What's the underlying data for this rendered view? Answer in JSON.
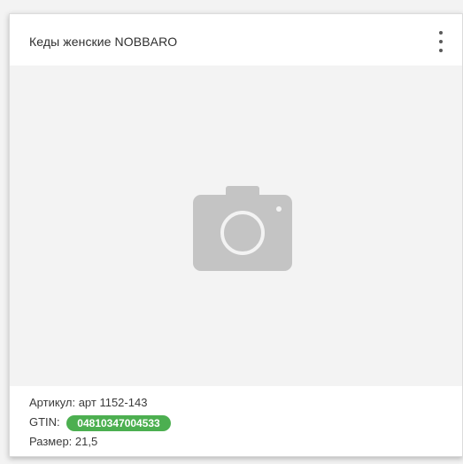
{
  "card": {
    "title": "Кеды женские NOBBARO",
    "menu_icon": "more-vert-icon",
    "placeholder_icon": "camera-icon",
    "article_label": "Артикул:",
    "article_value": "арт 1152-143",
    "gtin_label": "GTIN:",
    "gtin_value": "04810347004533",
    "size_label": "Размер:",
    "size_value": "21,5"
  },
  "colors": {
    "badge": "#4caf50",
    "image_bg": "#f3f3f3",
    "icon": "#c4c4c4"
  }
}
